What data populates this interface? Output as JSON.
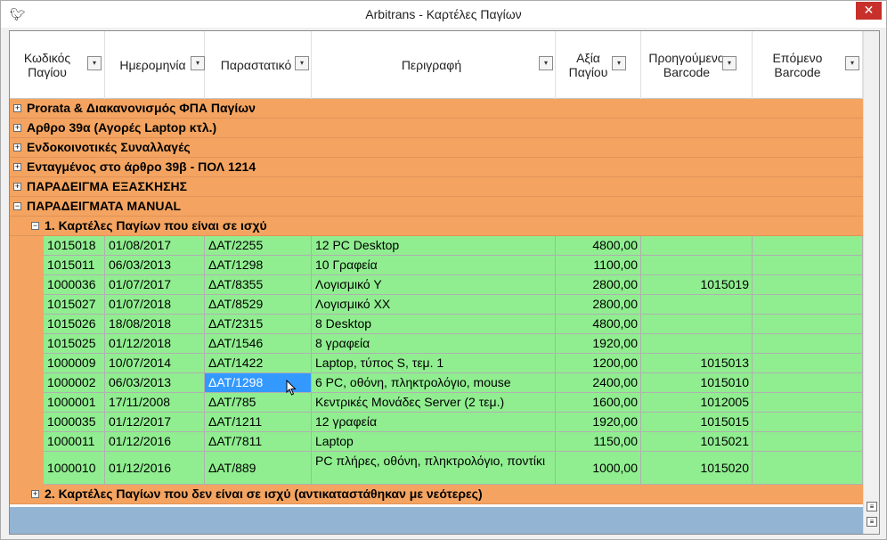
{
  "window": {
    "title": "Arbitrans - Καρτέλες Παγίων",
    "app_icon": "arbitrans-logo-icon",
    "close_label": "✕"
  },
  "columns": [
    {
      "label": "Κωδικός Παγίου",
      "filter": true
    },
    {
      "label": "Ημερομηνία",
      "filter": true
    },
    {
      "label": "Παραστατικό",
      "filter": true
    },
    {
      "label": "Περιγραφή",
      "filter": true
    },
    {
      "label": "Αξία Παγίου",
      "filter": true
    },
    {
      "label": "Προηγούμενο Barcode",
      "filter": true
    },
    {
      "label": "Επόμενο Barcode",
      "filter": true
    }
  ],
  "groups": [
    {
      "label": "Prorata & Διακανονισμός ΦΠΑ Παγίων",
      "expanded": false
    },
    {
      "label": "Αρθρο 39α (Αγορές Laptop κτλ.)",
      "expanded": false
    },
    {
      "label": "Ενδοκοινοτικές Συναλλαγές",
      "expanded": false
    },
    {
      "label": "Ενταγμένος στο άρθρο 39β - ΠΟΛ 1214",
      "expanded": false
    },
    {
      "label": "ΠΑΡΑΔΕΙΓΜΑ ΕΞΑΣΚΗΣΗΣ",
      "expanded": false
    },
    {
      "label": "ΠΑΡΑΔΕΙΓΜΑΤΑ MANUAL",
      "expanded": true
    }
  ],
  "subgroups": [
    {
      "label": "1. Καρτέλες Παγίων που είναι σε ισχύ",
      "expanded": true
    },
    {
      "label": "2. Καρτέλες Παγίων που δεν είναι σε ισχύ (αντικαταστάθηκαν με νεότερες)",
      "expanded": false
    }
  ],
  "rows": [
    {
      "code": "1015018",
      "date": "01/08/2017",
      "doc": "ΔΑΤ/2255",
      "desc": "12 PC Desktop",
      "value": "4800,00",
      "prev": "",
      "next": ""
    },
    {
      "code": "1015011",
      "date": "06/03/2013",
      "doc": "ΔΑΤ/1298",
      "desc": "10 Γραφεία",
      "value": "1100,00",
      "prev": "",
      "next": ""
    },
    {
      "code": "1000036",
      "date": "01/07/2017",
      "doc": "ΔΑΤ/8355",
      "desc": "Λογισμικό Υ",
      "value": "2800,00",
      "prev": "1015019",
      "next": ""
    },
    {
      "code": "1015027",
      "date": "01/07/2018",
      "doc": "ΔΑΤ/8529",
      "desc": "Λογισμικό ΧΧ",
      "value": "2800,00",
      "prev": "",
      "next": ""
    },
    {
      "code": "1015026",
      "date": "18/08/2018",
      "doc": "ΔΑΤ/2315",
      "desc": "8 Desktop",
      "value": "4800,00",
      "prev": "",
      "next": ""
    },
    {
      "code": "1015025",
      "date": "01/12/2018",
      "doc": "ΔΑΤ/1546",
      "desc": "8 γραφεία",
      "value": "1920,00",
      "prev": "",
      "next": ""
    },
    {
      "code": "1000009",
      "date": "10/07/2014",
      "doc": "ΔΑΤ/1422",
      "desc": "Laptop, τύπος S, τεμ. 1",
      "value": "1200,00",
      "prev": "1015013",
      "next": ""
    },
    {
      "code": "1000002",
      "date": "06/03/2013",
      "doc": "ΔΑΤ/1298",
      "desc": "6 PC, οθόνη, πληκτρολόγιο, mouse",
      "value": "2400,00",
      "prev": "1015010",
      "next": "",
      "selected_doc": true
    },
    {
      "code": "1000001",
      "date": "17/11/2008",
      "doc": "ΔΑΤ/785",
      "desc": "Κεντρικές Μονάδες Server (2 τεμ.)",
      "value": "1600,00",
      "prev": "1012005",
      "next": ""
    },
    {
      "code": "1000035",
      "date": "01/12/2017",
      "doc": "ΔΑΤ/1211",
      "desc": "12 γραφεία",
      "value": "1920,00",
      "prev": "1015015",
      "next": ""
    },
    {
      "code": "1000011",
      "date": "01/12/2016",
      "doc": "ΔΑΤ/7811",
      "desc": "Laptop",
      "value": "1150,00",
      "prev": "1015021",
      "next": ""
    },
    {
      "code": "1000010",
      "date": "01/12/2016",
      "doc": "ΔΑΤ/889",
      "desc": "PC πλήρες, οθόνη, πληκτρολόγιο, ποντίκι",
      "value": "1000,00",
      "prev": "1015020",
      "next": ""
    }
  ],
  "icons": {
    "expand": "+",
    "collapse": "−",
    "filter": "▾",
    "scroll_up": "≡",
    "scroll_down": "≡"
  }
}
